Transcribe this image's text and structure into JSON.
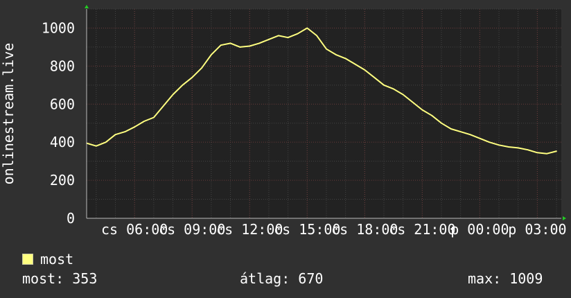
{
  "colors": {
    "background": "#303030",
    "plot_background": "#222222",
    "series": "#ffff80",
    "grid_major": "#6a3a3a",
    "grid_minor": "#444444",
    "axis": "#ffffff",
    "arrow": "#22cc22"
  },
  "legend": {
    "swatch_color": "#ffff80",
    "label": "most"
  },
  "stats": {
    "current": "most: 353",
    "average": "átlag: 670",
    "max": "max: 1009"
  },
  "chart_data": {
    "type": "line",
    "title": "",
    "ylabel": "onlinestream.live",
    "xlabel": "",
    "ylim": [
      0,
      1100
    ],
    "x_range_hours": [
      3.5,
      28.25
    ],
    "yticks": [
      0,
      200,
      400,
      600,
      800,
      1000
    ],
    "xticks": [
      {
        "hour": 6,
        "label": "cs 06:00"
      },
      {
        "hour": 9,
        "label": "cs 09:00"
      },
      {
        "hour": 12,
        "label": "cs 12:00"
      },
      {
        "hour": 15,
        "label": "cs 15:00"
      },
      {
        "hour": 18,
        "label": "cs 18:00"
      },
      {
        "hour": 21,
        "label": "cs 21:00"
      },
      {
        "hour": 24,
        "label": "p 00:00"
      },
      {
        "hour": 27,
        "label": "p 03:00"
      }
    ],
    "grid": true,
    "legend_position": "bottom-left",
    "series": [
      {
        "name": "most",
        "x": [
          3.5,
          4.0,
          4.5,
          5.0,
          5.5,
          6.0,
          6.5,
          7.0,
          7.5,
          8.0,
          8.5,
          9.0,
          9.5,
          10.0,
          10.5,
          11.0,
          11.5,
          12.0,
          12.5,
          13.0,
          13.5,
          14.0,
          14.5,
          15.0,
          15.5,
          16.0,
          16.5,
          17.0,
          17.5,
          18.0,
          18.5,
          19.0,
          19.5,
          20.0,
          20.5,
          21.0,
          21.5,
          22.0,
          22.5,
          23.0,
          23.5,
          24.0,
          24.5,
          25.0,
          25.5,
          26.0,
          26.5,
          27.0,
          27.5,
          28.0
        ],
        "values": [
          395,
          380,
          400,
          440,
          455,
          480,
          510,
          530,
          590,
          650,
          700,
          740,
          790,
          860,
          910,
          920,
          900,
          905,
          920,
          940,
          960,
          950,
          970,
          1000,
          960,
          890,
          860,
          840,
          810,
          780,
          740,
          700,
          680,
          650,
          610,
          570,
          540,
          500,
          470,
          455,
          440,
          420,
          400,
          385,
          375,
          370,
          360,
          345,
          340,
          353
        ]
      }
    ]
  }
}
